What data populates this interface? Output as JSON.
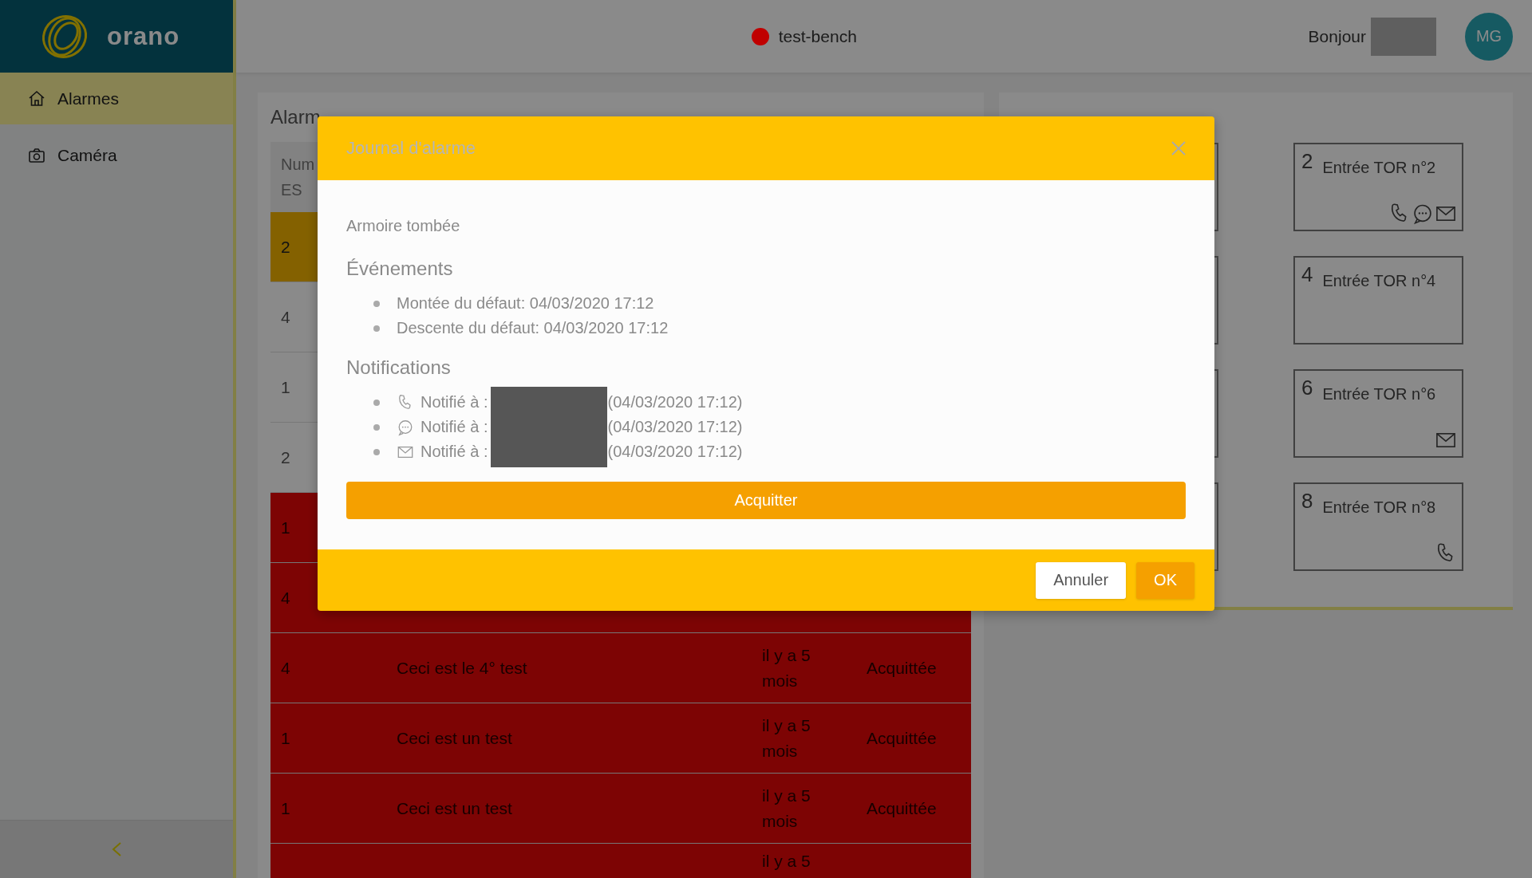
{
  "brand": {
    "name": "orano"
  },
  "sidebar": {
    "items": [
      {
        "label": "Alarmes",
        "selected": true
      },
      {
        "label": "Caméra",
        "selected": false
      }
    ]
  },
  "topbar": {
    "site": {
      "name": "test-bench",
      "color": "#c00000"
    },
    "greeting": "Bonjour",
    "avatar": "MG"
  },
  "alarms": {
    "title": "Alarm",
    "columns": [
      "Num ES"
    ],
    "rows": [
      {
        "kind": "warning",
        "num": "2"
      },
      {
        "kind": "normal",
        "num": "4"
      },
      {
        "kind": "normal",
        "num": "1"
      },
      {
        "kind": "normal",
        "num": "2"
      },
      {
        "kind": "alarm",
        "num": "1"
      },
      {
        "kind": "alarm",
        "num": "4"
      },
      {
        "kind": "alarm",
        "num": "4",
        "message": "Ceci est le 4° test",
        "time": "il y a 5 mois",
        "state": "Acquittée"
      },
      {
        "kind": "alarm",
        "num": "1",
        "message": "Ceci est un test",
        "time": "il y a 5 mois",
        "state": "Acquittée"
      },
      {
        "kind": "alarm",
        "num": "1",
        "message": "Ceci est un test",
        "time": "il y a 5 mois",
        "state": "Acquittée"
      },
      {
        "kind": "alarm",
        "time": "il y a 5"
      }
    ]
  },
  "inputs": [
    {
      "num": "2",
      "label": "Entrée TOR n°2",
      "channels": [
        {
          "kind": "phone"
        },
        {
          "kind": "message"
        },
        {
          "kind": "mail"
        }
      ]
    },
    {
      "num": "4",
      "label": "Entrée TOR n°4"
    },
    {
      "num": "6",
      "label": "Entrée TOR n°6",
      "channels": [
        {
          "kind": "mail"
        }
      ]
    },
    {
      "num": "8",
      "label": "Entrée TOR n°8",
      "channels": [
        {
          "kind": "phone"
        }
      ]
    }
  ],
  "modal": {
    "title": "Journal d'alarme",
    "subject": "Armoire tombée",
    "events_title": "Événements",
    "events": [
      "Montée du défaut: 04/03/2020 17:12",
      "Descente du défaut: 04/03/2020 17:12"
    ],
    "notifications_title": "Notifications",
    "notifications": [
      {
        "kind": "phone",
        "label": "Notifié à :",
        "time": "(04/03/2020 17:12)"
      },
      {
        "kind": "message",
        "label": "Notifié à :",
        "time": "(04/03/2020 17:12)"
      },
      {
        "kind": "mail",
        "label": "Notifié à :",
        "time": "(04/03/2020 17:12)"
      }
    ],
    "primary": "Acquitter",
    "buttons": [
      "Annuler",
      "OK"
    ]
  }
}
